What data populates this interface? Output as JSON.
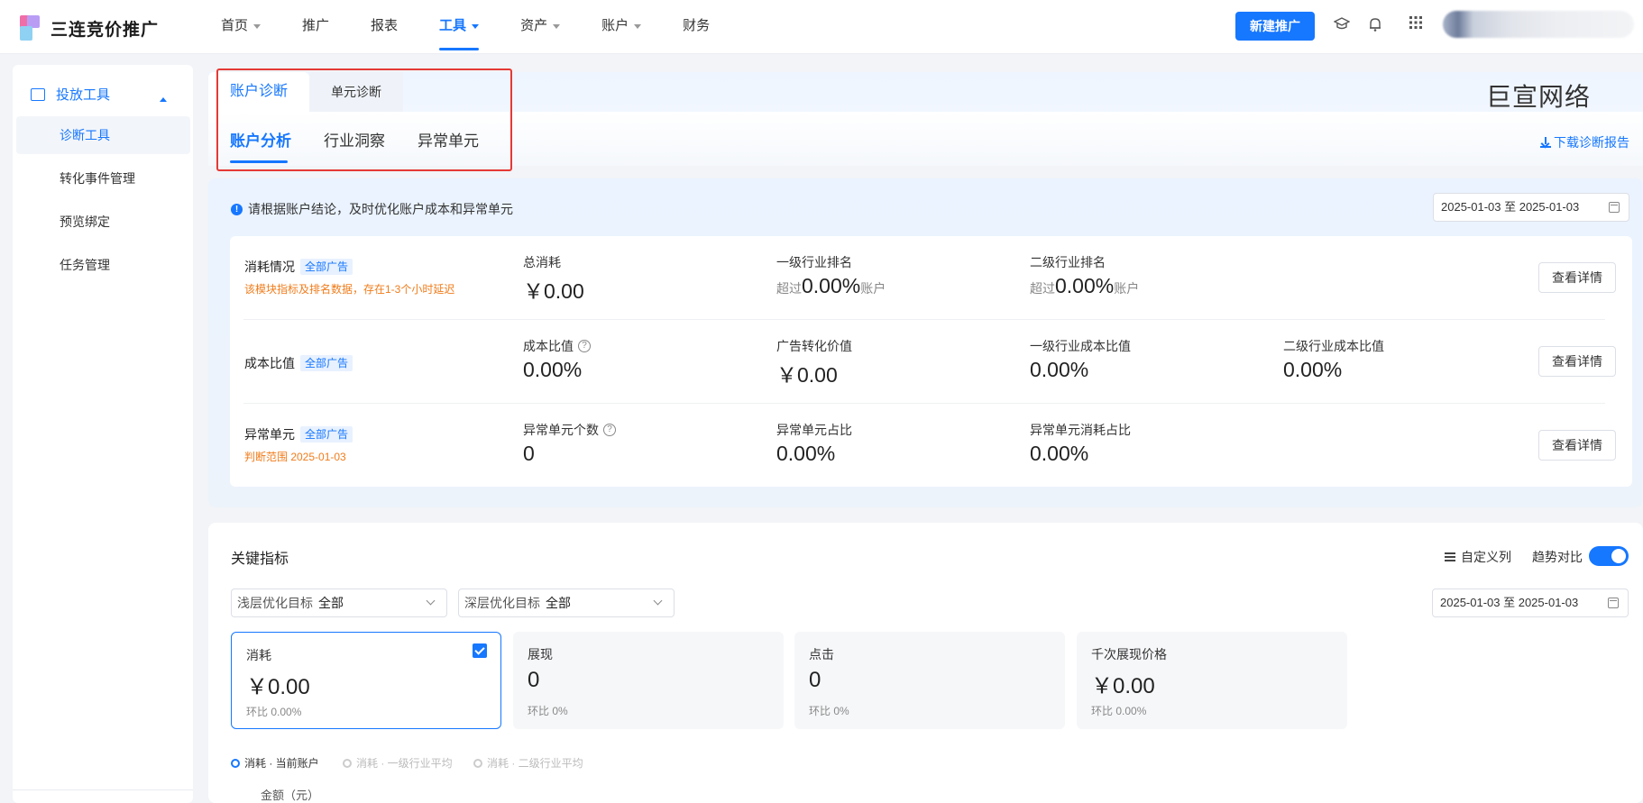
{
  "logo": {
    "text": "三连竞价推广"
  },
  "nav": {
    "items": [
      {
        "label": "首页",
        "caret": true
      },
      {
        "label": "推广",
        "caret": false
      },
      {
        "label": "报表",
        "caret": false
      },
      {
        "label": "工具",
        "caret": true,
        "active": true
      },
      {
        "label": "资产",
        "caret": true
      },
      {
        "label": "账户",
        "caret": true
      },
      {
        "label": "财务",
        "caret": false
      }
    ],
    "new_button": "新建推广"
  },
  "sidebar": {
    "group": "投放工具",
    "items": [
      "诊断工具",
      "转化事件管理",
      "预览绑定",
      "任务管理"
    ]
  },
  "subtabs": [
    "账户诊断",
    "单元诊断"
  ],
  "brand_right": "巨宣网络",
  "second_tabs": [
    "账户分析",
    "行业洞察",
    "异常单元"
  ],
  "download_label": "下载诊断报告",
  "tip": "请根据账户结论，及时优化账户成本和异常单元",
  "date_range": "2025-01-03 至 2025-01-03",
  "diagnosis": {
    "tag": "全部广告",
    "detail_button": "查看详情",
    "rows": [
      {
        "label": "消耗情况",
        "note": "该模块指标及排名数据，存在1-3个小时延迟",
        "metrics": [
          {
            "title": "总消耗",
            "value": "￥0.00"
          },
          {
            "title": "一级行业排名",
            "prefix": "超过",
            "value": "0.00%",
            "suffix": "账户"
          },
          {
            "title": "二级行业排名",
            "prefix": "超过",
            "value": "0.00%",
            "suffix": "账户"
          }
        ]
      },
      {
        "label": "成本比值",
        "note": "",
        "metrics": [
          {
            "title": "成本比值",
            "value": "0.00%",
            "help": true
          },
          {
            "title": "广告转化价值",
            "value": "￥0.00"
          },
          {
            "title": "一级行业成本比值",
            "value": "0.00%"
          },
          {
            "title": "二级行业成本比值",
            "value": "0.00%"
          }
        ]
      },
      {
        "label": "异常单元",
        "note": "判断范围 2025-01-03",
        "metrics": [
          {
            "title": "异常单元个数",
            "value": "0",
            "help": true
          },
          {
            "title": "异常单元占比",
            "value": "0.00%"
          },
          {
            "title": "异常单元消耗占比",
            "value": "0.00%"
          }
        ]
      }
    ]
  },
  "key_indicators": {
    "title": "关键指标",
    "custom_columns": "自定义列",
    "trend_compare": "趋势对比",
    "filters": [
      {
        "label": "浅层优化目标",
        "value": "全部"
      },
      {
        "label": "深层优化目标",
        "value": "全部"
      }
    ],
    "date_range": "2025-01-03 至 2025-01-03",
    "kpis": [
      {
        "name": "消耗",
        "value": "￥0.00",
        "compare": "环比  0.00%",
        "selected": true
      },
      {
        "name": "展现",
        "value": "0",
        "compare": "环比  0%",
        "selected": false
      },
      {
        "name": "点击",
        "value": "0",
        "compare": "环比  0%",
        "selected": false
      },
      {
        "name": "千次展现价格",
        "value": "￥0.00",
        "compare": "环比  0.00%",
        "selected": false
      }
    ],
    "legend": [
      {
        "label": "消耗 · 当前账户",
        "active": true
      },
      {
        "label": "消耗 · 一级行业平均",
        "active": false
      },
      {
        "label": "消耗 · 二级行业平均",
        "active": false
      }
    ],
    "y_axis_label": "金额（元）"
  },
  "colors": {
    "accent": "#1677ff",
    "warning": "#f07c1b",
    "highlight": "#e53935"
  }
}
